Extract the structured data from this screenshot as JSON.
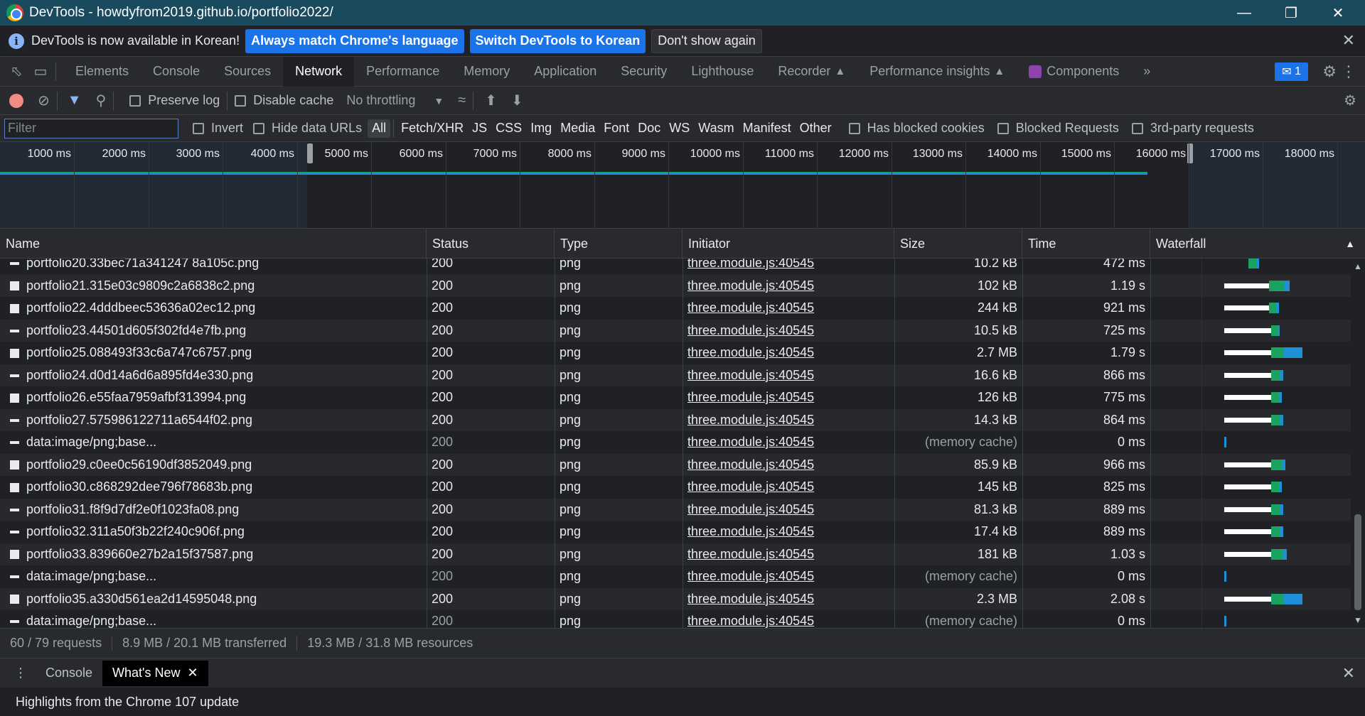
{
  "window": {
    "title": "DevTools - howdyfrom2019.github.io/portfolio2022/"
  },
  "infobar": {
    "message": "DevTools is now available in Korean!",
    "btn_match": "Always match Chrome's language",
    "btn_switch": "Switch DevTools to Korean",
    "btn_dont": "Don't show again"
  },
  "tabs": [
    {
      "label": "Elements"
    },
    {
      "label": "Console"
    },
    {
      "label": "Sources"
    },
    {
      "label": "Network"
    },
    {
      "label": "Performance"
    },
    {
      "label": "Memory"
    },
    {
      "label": "Application"
    },
    {
      "label": "Security"
    },
    {
      "label": "Lighthouse"
    },
    {
      "label": "Recorder"
    },
    {
      "label": "Performance insights"
    },
    {
      "label": "Components"
    }
  ],
  "issues_count": "1",
  "toolbar": {
    "preserve_log": "Preserve log",
    "disable_cache": "Disable cache",
    "throttling": "No throttling"
  },
  "filter": {
    "placeholder": "Filter",
    "invert": "Invert",
    "hide_data_urls": "Hide data URLs",
    "types": [
      "All",
      "Fetch/XHR",
      "JS",
      "CSS",
      "Img",
      "Media",
      "Font",
      "Doc",
      "WS",
      "Wasm",
      "Manifest",
      "Other"
    ],
    "has_blocked_cookies": "Has blocked cookies",
    "blocked_requests": "Blocked Requests",
    "third_party": "3rd-party requests"
  },
  "overview": {
    "ticks": [
      "1000 ms",
      "2000 ms",
      "3000 ms",
      "4000 ms",
      "5000 ms",
      "6000 ms",
      "7000 ms",
      "8000 ms",
      "9000 ms",
      "10000 ms",
      "11000 ms",
      "12000 ms",
      "13000 ms",
      "14000 ms",
      "15000 ms",
      "16000 ms",
      "17000 ms",
      "18000 ms"
    ]
  },
  "table": {
    "headers": {
      "name": "Name",
      "status": "Status",
      "type": "Type",
      "initiator": "Initiator",
      "size": "Size",
      "time": "Time",
      "waterfall": "Waterfall"
    },
    "rows": [
      {
        "name": "portfolio20.33bec71a341247 8a105c.png",
        "status": "200",
        "type": "png",
        "initiator": "three.module.js:40545",
        "size": "10.2 kB",
        "time": "472 ms",
        "wf_start": 0.49,
        "wf_wait": 0,
        "wf_dl": 0.12,
        "icon": "thin",
        "cut": true
      },
      {
        "name": "portfolio21.315e03c9809c2a6838c2.png",
        "status": "200",
        "type": "png",
        "initiator": "three.module.js:40545",
        "size": "102 kB",
        "time": "1.19 s",
        "wf_start": 0.37,
        "wf_wait": 0.52,
        "wf_dl": 0.24,
        "icon": "box"
      },
      {
        "name": "portfolio22.4dddbeec53636a02ec12.png",
        "status": "200",
        "type": "png",
        "initiator": "three.module.js:40545",
        "size": "244 kB",
        "time": "921 ms",
        "wf_start": 0.37,
        "wf_wait": 0.52,
        "wf_dl": 0.12,
        "icon": "box"
      },
      {
        "name": "portfolio23.44501d605f302fd4e7fb.png",
        "status": "200",
        "type": "png",
        "initiator": "three.module.js:40545",
        "size": "10.5 kB",
        "time": "725 ms",
        "wf_start": 0.37,
        "wf_wait": 0.55,
        "wf_dl": 0.1,
        "icon": "thin"
      },
      {
        "name": "portfolio25.088493f33c6a747c6757.png",
        "status": "200",
        "type": "png",
        "initiator": "three.module.js:40545",
        "size": "2.7 MB",
        "time": "1.79 s",
        "wf_start": 0.37,
        "wf_wait": 0.55,
        "wf_dl": 0.36,
        "icon": "box"
      },
      {
        "name": "portfolio24.d0d14a6d6a895fd4e330.png",
        "status": "200",
        "type": "png",
        "initiator": "three.module.js:40545",
        "size": "16.6 kB",
        "time": "866 ms",
        "wf_start": 0.37,
        "wf_wait": 0.55,
        "wf_dl": 0.14,
        "icon": "thin"
      },
      {
        "name": "portfolio26.e55faa7959afbf313994.png",
        "status": "200",
        "type": "png",
        "initiator": "three.module.js:40545",
        "size": "126 kB",
        "time": "775 ms",
        "wf_start": 0.37,
        "wf_wait": 0.55,
        "wf_dl": 0.12,
        "icon": "box"
      },
      {
        "name": "portfolio27.575986122711a6544f02.png",
        "status": "200",
        "type": "png",
        "initiator": "three.module.js:40545",
        "size": "14.3 kB",
        "time": "864 ms",
        "wf_start": 0.37,
        "wf_wait": 0.55,
        "wf_dl": 0.14,
        "icon": "thin"
      },
      {
        "name": "data:image/png;base...",
        "status": "200",
        "type": "png",
        "initiator": "three.module.js:40545",
        "size": "(memory cache)",
        "time": "0 ms",
        "wf_start": 0.37,
        "wf_wait": 0,
        "wf_dl": 0.02,
        "icon": "thin",
        "cached": true
      },
      {
        "name": "portfolio29.c0ee0c56190df3852049.png",
        "status": "200",
        "type": "png",
        "initiator": "three.module.js:40545",
        "size": "85.9 kB",
        "time": "966 ms",
        "wf_start": 0.37,
        "wf_wait": 0.55,
        "wf_dl": 0.16,
        "icon": "box"
      },
      {
        "name": "portfolio30.c868292dee796f78683b.png",
        "status": "200",
        "type": "png",
        "initiator": "three.module.js:40545",
        "size": "145 kB",
        "time": "825 ms",
        "wf_start": 0.37,
        "wf_wait": 0.55,
        "wf_dl": 0.12,
        "icon": "box"
      },
      {
        "name": "portfolio31.f8f9d7df2e0f1023fa08.png",
        "status": "200",
        "type": "png",
        "initiator": "three.module.js:40545",
        "size": "81.3 kB",
        "time": "889 ms",
        "wf_start": 0.37,
        "wf_wait": 0.55,
        "wf_dl": 0.14,
        "icon": "thin"
      },
      {
        "name": "portfolio32.311a50f3b22f240c906f.png",
        "status": "200",
        "type": "png",
        "initiator": "three.module.js:40545",
        "size": "17.4 kB",
        "time": "889 ms",
        "wf_start": 0.37,
        "wf_wait": 0.55,
        "wf_dl": 0.14,
        "icon": "thin"
      },
      {
        "name": "portfolio33.839660e27b2a15f37587.png",
        "status": "200",
        "type": "png",
        "initiator": "three.module.js:40545",
        "size": "181 kB",
        "time": "1.03 s",
        "wf_start": 0.37,
        "wf_wait": 0.55,
        "wf_dl": 0.18,
        "icon": "box"
      },
      {
        "name": "data:image/png;base...",
        "status": "200",
        "type": "png",
        "initiator": "three.module.js:40545",
        "size": "(memory cache)",
        "time": "0 ms",
        "wf_start": 0.37,
        "wf_wait": 0,
        "wf_dl": 0.02,
        "icon": "thin",
        "cached": true
      },
      {
        "name": "portfolio35.a330d561ea2d14595048.png",
        "status": "200",
        "type": "png",
        "initiator": "three.module.js:40545",
        "size": "2.3 MB",
        "time": "2.08 s",
        "wf_start": 0.37,
        "wf_wait": 0.55,
        "wf_dl": 0.36,
        "icon": "box"
      },
      {
        "name": "data:image/png;base...",
        "status": "200",
        "type": "png",
        "initiator": "three.module.js:40545",
        "size": "(memory cache)",
        "time": "0 ms",
        "wf_start": 0.37,
        "wf_wait": 0,
        "wf_dl": 0.02,
        "icon": "thin",
        "cached": true
      }
    ]
  },
  "status": {
    "requests": "60 / 79 requests",
    "transferred": "8.9 MB / 20.1 MB transferred",
    "resources": "19.3 MB / 31.8 MB resources"
  },
  "drawer": {
    "tab_console": "Console",
    "tab_whats_new": "What's New",
    "content": "Highlights from the Chrome 107 update"
  },
  "colors": {
    "wf_wait": "#ffffff",
    "wf_download": "#1aa260",
    "wf_download_alt": "#1e90d8",
    "timeline_green": "#1aa260",
    "timeline_blue": "#1e88e5"
  }
}
